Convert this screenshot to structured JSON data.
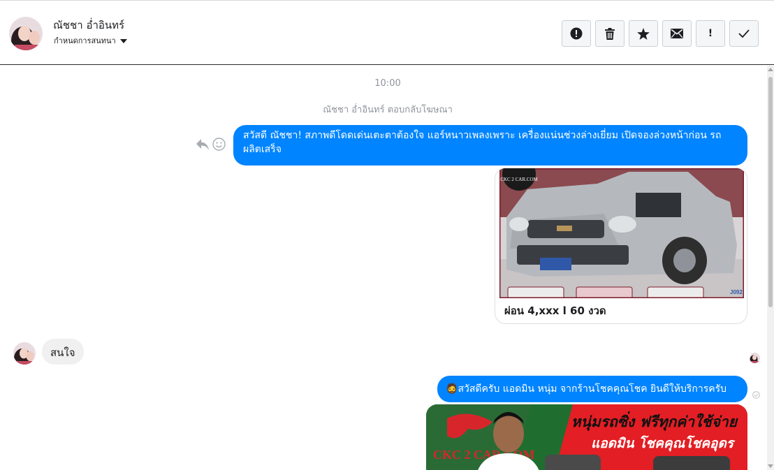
{
  "header": {
    "contact_name": "ณัชชา อ่ำอินทร์",
    "assign_label": "กำหนดการสนทนา",
    "toolbar": [
      {
        "name": "spam-button",
        "icon": "alert-circle-icon"
      },
      {
        "name": "delete-button",
        "icon": "trash-icon"
      },
      {
        "name": "star-button",
        "icon": "star-icon"
      },
      {
        "name": "mark-unread-button",
        "icon": "envelope-icon"
      },
      {
        "name": "follow-up-button",
        "icon": "exclamation-icon",
        "label": "!"
      },
      {
        "name": "mark-done-button",
        "icon": "checkmark-icon"
      }
    ]
  },
  "thread": {
    "timestamp": "10:00",
    "event_text": "ณัชชา อ่ำอินทร์ ตอบกลับโฆษณา",
    "messages": [
      {
        "direction": "outgoing",
        "text": "สวัสดี ณัชชา! สภาพดีโดดเด่นเตะตาต้องใจ แอร์หนาวเพลงเพราะ เครื่องแน่นช่วงล่างเยี่ยม เปิดจองล่วงหน้าก่อน รถผลิตเสร็จ"
      },
      {
        "direction": "outgoing",
        "type": "card",
        "image_logo": "CKC 2 CAR.COM",
        "image_code": "J092",
        "caption": "ผ่อน 4,xxx l 60 งวด"
      },
      {
        "direction": "incoming",
        "text": "สนใจ"
      },
      {
        "direction": "outgoing",
        "emoji": "🧔",
        "text": "สวัสดีครับ แอดมิน หนุ่ม จากร้านโชคคุณโชค ยินดีให้บริการครับ"
      },
      {
        "direction": "outgoing",
        "type": "image",
        "banner_line1": "หนุ่มรถซิ่ง ฟรีทุกค่าใช้จ่าย",
        "banner_line2": "แอดมิน โชคคุณโชคอุดร",
        "banner_logo": "CKC 2 CAR.COM"
      }
    ]
  },
  "colors": {
    "outgoing_bubble": "#0084ff",
    "incoming_bubble": "#f1f0f0",
    "meta_text": "#90949c",
    "banner_red": "#e31e24",
    "banner_green": "#1f6e2f"
  }
}
